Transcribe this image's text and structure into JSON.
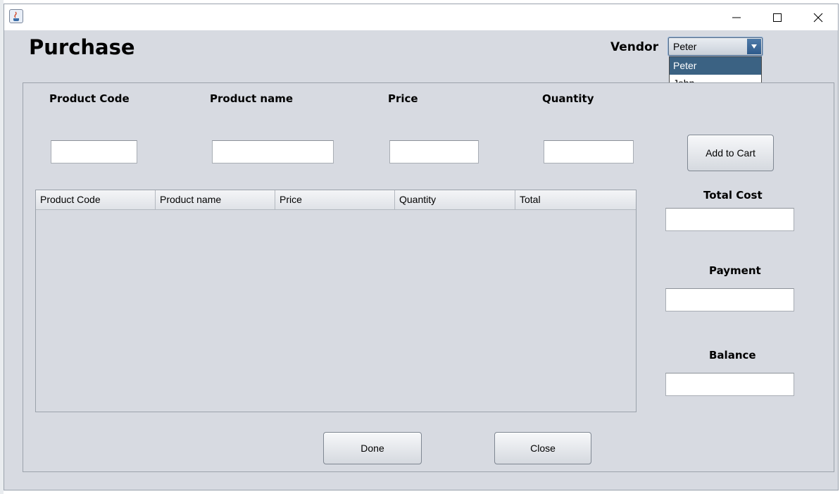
{
  "window": {
    "app_icon": "java-cup-icon",
    "controls": [
      "minimize-icon",
      "maximize-icon",
      "close-icon"
    ]
  },
  "page": {
    "title": "Purchase"
  },
  "vendor": {
    "label": "Vendor",
    "selected": "Peter",
    "options": [
      "Peter",
      "John"
    ]
  },
  "fields": {
    "product_code_label": "Product Code",
    "product_name_label": "Product name",
    "price_label": "Price",
    "quantity_label": "Quantity",
    "product_code_value": "",
    "product_name_value": "",
    "price_value": "",
    "quantity_value": ""
  },
  "buttons": {
    "add_to_cart": "Add to Cart",
    "done": "Done",
    "close": "Close"
  },
  "table": {
    "columns": [
      "Product Code",
      "Product name",
      "Price",
      "Quantity",
      "Total"
    ],
    "rows": []
  },
  "summary": {
    "total_cost_label": "Total Cost",
    "payment_label": "Payment",
    "balance_label": "Balance",
    "total_cost_value": "",
    "payment_value": "",
    "balance_value": ""
  },
  "colors": {
    "window_bg": "#d7dae1",
    "selection": "#3b6283"
  }
}
